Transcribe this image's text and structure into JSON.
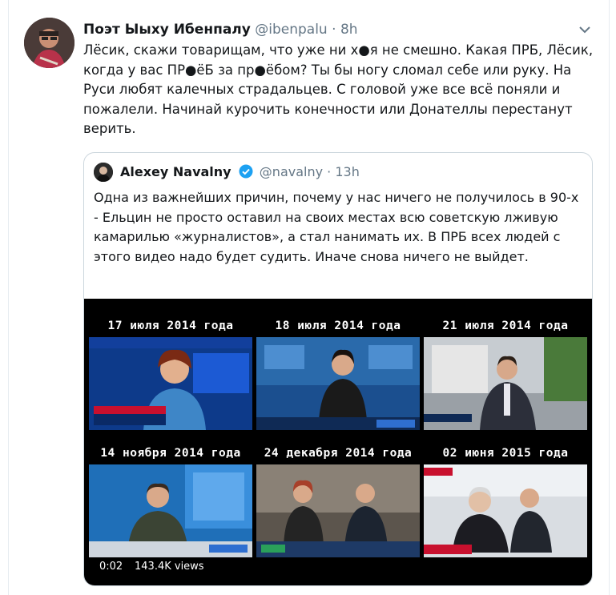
{
  "tweet": {
    "author_name": "Поэт Ыыху Ибенпалу",
    "handle": "@ibenpalu",
    "separator": "·",
    "time": "8h",
    "text": "Лёсик, скажи товарищам, что уже ни х●я не смешно. Какая ПРБ, Лёсик, когда у вас ПР●ёБ за пр●ёбом? Ты бы ногу сломал себе или руку. На Руси любят калечных страдальцев. С головой уже все всё поняли и пожалели. Начинай курочить конечности или Донателлы перестанут верить."
  },
  "quoted": {
    "author_name": "Alexey Navalny",
    "handle": "@navalny",
    "separator": "·",
    "time": "13h",
    "text": "Одна из важнейших причин, почему у нас ничего не получилось в 90-х - Ельцин не просто оставил на своих местах всю советскую лживую камарилью «журналистов», а стал нанимать их. В ПРБ всех людей с этого видео надо будет судить. Иначе снова ничего не выйдет."
  },
  "video": {
    "duration": "0:02",
    "views": "143.4K views",
    "panels": [
      {
        "date": "17 июля 2014 года",
        "scene": "news-studio-woman-blue"
      },
      {
        "date": "18 июля 2014 года",
        "scene": "news-studio-woman-dark"
      },
      {
        "date": "21 июля 2014 года",
        "scene": "reporter-street"
      },
      {
        "date": "14 ноября 2014 года",
        "scene": "news-studio-man"
      },
      {
        "date": "24 декабря 2014 года",
        "scene": "news-two-anchors"
      },
      {
        "date": "02 июня 2015 года",
        "scene": "press-conference"
      }
    ]
  },
  "colors": {
    "text": "#14171a",
    "secondary": "#657786",
    "verified": "#1da1f2",
    "border": "#ccd6dd"
  },
  "icons": [
    "chevron-down-icon",
    "verified-badge-icon"
  ]
}
